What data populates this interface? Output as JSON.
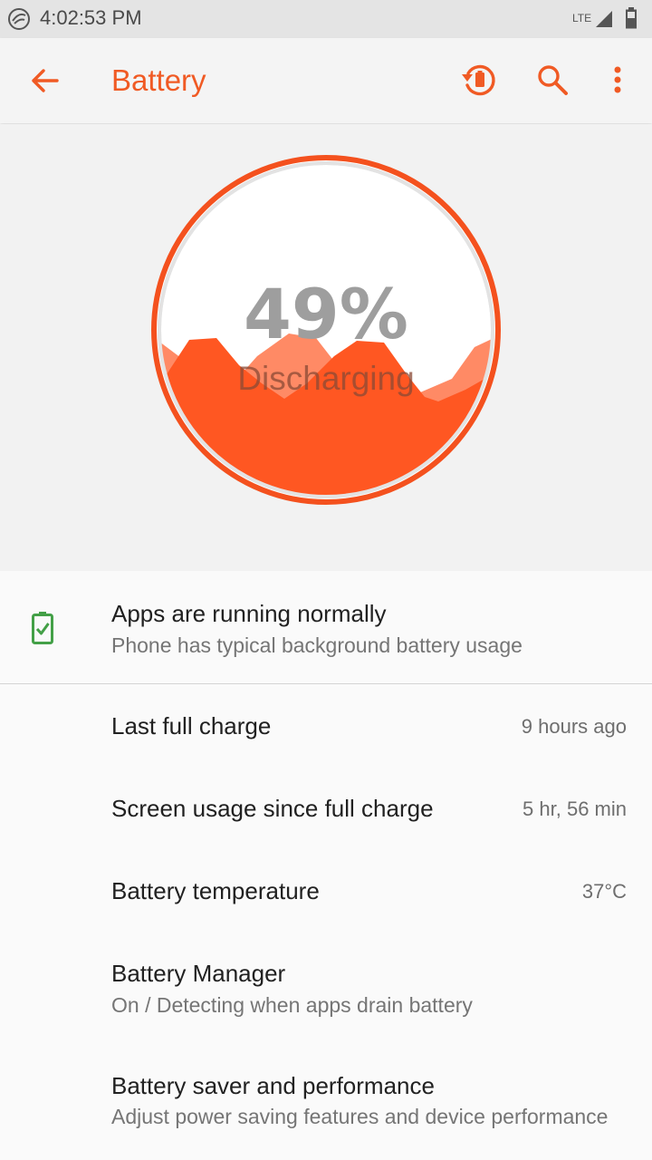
{
  "status_bar": {
    "time": "4:02:53 PM",
    "network": "LTE",
    "battery_level": "49"
  },
  "app_bar": {
    "title": "Battery",
    "actions": [
      "history-icon",
      "search-icon",
      "more-vert-icon"
    ]
  },
  "gauge": {
    "percent_label": "49%",
    "state_label": "Discharging",
    "level": 0.49,
    "colors": {
      "fill": "#ff5722",
      "wave_light": "#ff8a65",
      "ring": "#f4511e",
      "text": "#9e9e9e"
    }
  },
  "status_card": {
    "title": "Apps are running normally",
    "subtitle": "Phone has typical background battery usage",
    "icon": "battery-check-icon",
    "icon_color": "#43a047"
  },
  "items": [
    {
      "title": "Last full charge",
      "value": "9 hours ago"
    },
    {
      "title": "Screen usage since full charge",
      "value": "5 hr, 56 min"
    },
    {
      "title": "Battery temperature",
      "value": "37°C"
    },
    {
      "title": "Battery Manager",
      "subtitle": "On / Detecting when apps drain battery"
    },
    {
      "title": "Battery saver and performance",
      "subtitle": "Adjust power saving features and device performance"
    }
  ],
  "accent_color": "#f05a24"
}
